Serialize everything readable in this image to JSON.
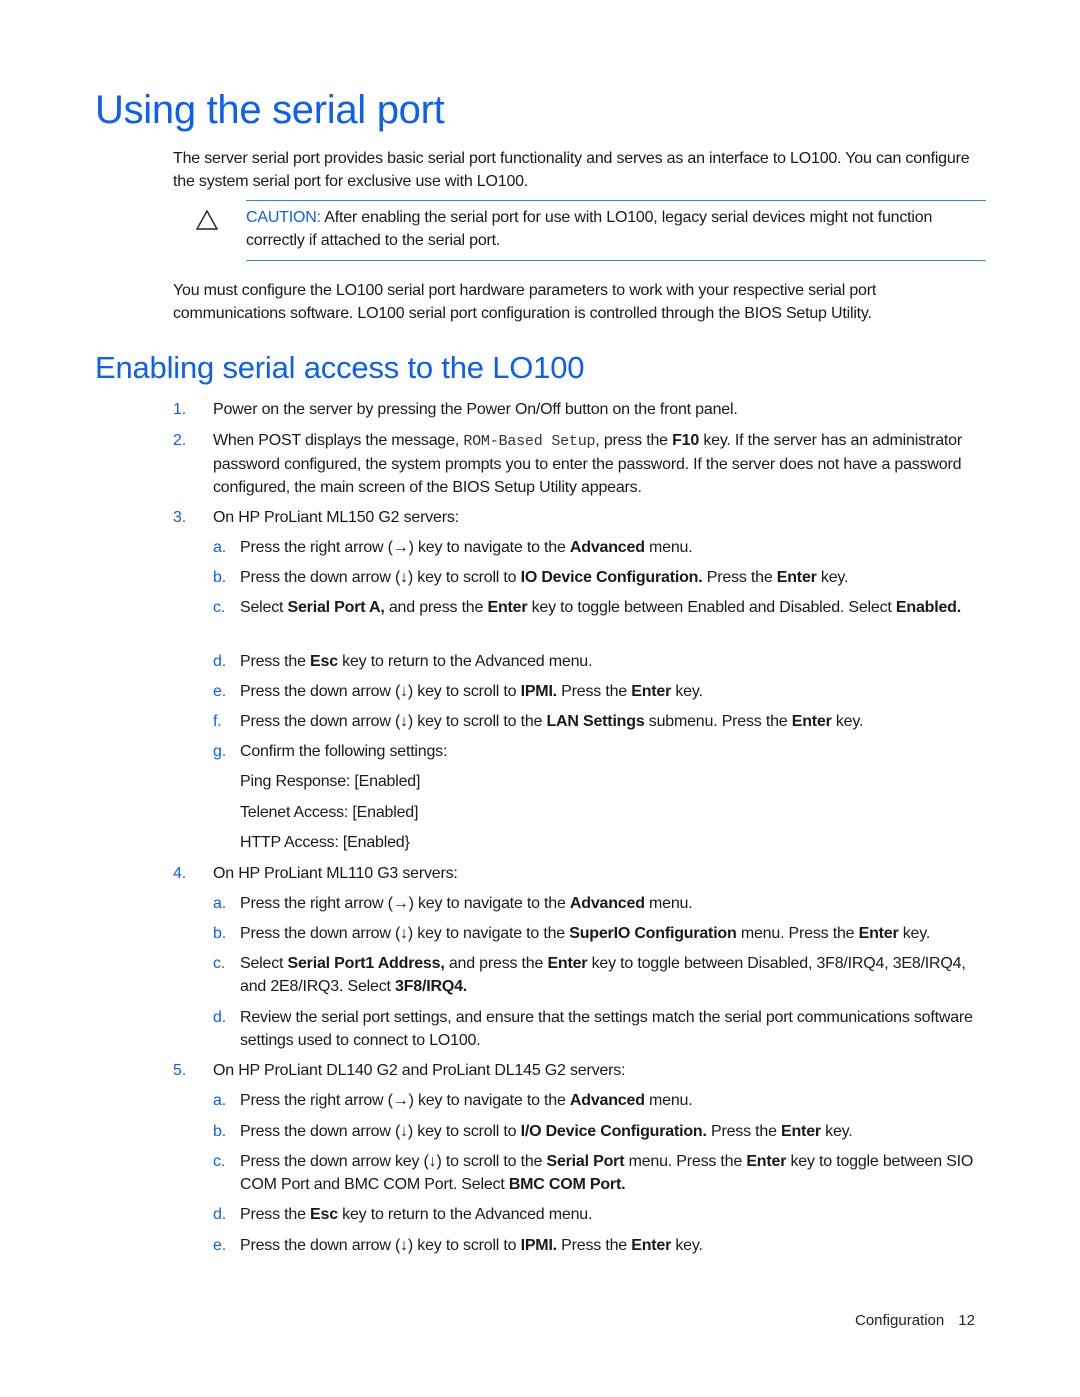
{
  "heading1": "Using the serial port",
  "intro": "The server serial port provides basic serial port functionality and serves as an interface to LO100. You can configure the system serial port for exclusive use with LO100.",
  "caution": {
    "icon": "warning-triangle-icon",
    "label": "CAUTION:",
    "text": "After enabling the serial port for use with LO100, legacy serial devices might not function correctly if attached to the serial port."
  },
  "para2": "You must configure the LO100 serial port hardware parameters to work with your respective serial port communications software. LO100 serial port configuration is controlled through the BIOS Setup Utility.",
  "heading2": "Enabling serial access to the LO100",
  "steps": [
    {
      "num": "1.",
      "text": "Power on the server by pressing the Power On/Off button on the front panel."
    },
    {
      "num": "2.",
      "pre": "When POST displays the message, ",
      "code": "ROM-Based Setup",
      "mid": ", press the ",
      "bold": "F10",
      "post": " key. If the server has an administrator password configured, the system prompts you to enter the password. If the server does not have a password configured, the main screen of the BIOS Setup Utility appears."
    },
    {
      "num": "3.",
      "text": "On HP ProLiant ML150 G2 servers:",
      "subs": [
        {
          "num": "a.",
          "parts": [
            "Press the right arrow (→) key to navigate to the ",
            "Advanced",
            " menu."
          ]
        },
        {
          "num": "b.",
          "parts": [
            "Press the down arrow (↓) key to scroll to ",
            "IO Device Configuration.",
            " Press the ",
            "Enter",
            " key."
          ]
        },
        {
          "num": "c.",
          "parts": [
            "Select ",
            "Serial Port A,",
            " and press the ",
            "Enter",
            " key to toggle between Enabled and Disabled. Select ",
            "Enabled."
          ]
        },
        {
          "num": "d.",
          "parts": [
            "Press the ",
            "Esc",
            " key to return to the Advanced menu."
          ]
        },
        {
          "num": "e.",
          "parts": [
            "Press the down arrow (↓) key to scroll to ",
            "IPMI.",
            " Press the ",
            "Enter",
            " key."
          ]
        },
        {
          "num": "f.",
          "parts": [
            "Press the down arrow (↓) key to scroll to the ",
            "LAN Settings",
            " submenu. Press the ",
            "Enter",
            " key."
          ]
        },
        {
          "num": "g.",
          "parts": [
            "Confirm the following settings:"
          ]
        }
      ],
      "settings": [
        "Ping Response: [Enabled]",
        "Telenet Access: [Enabled]",
        "HTTP Access: [Enabled}"
      ]
    },
    {
      "num": "4.",
      "text": "On HP ProLiant ML110 G3 servers:",
      "subs": [
        {
          "num": "a.",
          "parts": [
            "Press the right arrow (→) key to navigate to the ",
            "Advanced",
            " menu."
          ]
        },
        {
          "num": "b.",
          "parts": [
            "Press the down arrow (↓) key to navigate to the ",
            "SuperIO Configuration",
            " menu. Press the ",
            "Enter",
            " key."
          ]
        },
        {
          "num": "c.",
          "parts": [
            "Select ",
            "Serial Port1 Address,",
            " and press the ",
            "Enter",
            " key to toggle between Disabled, 3F8/IRQ4, 3E8/IRQ4, and 2E8/IRQ3. Select ",
            "3F8/IRQ4."
          ]
        },
        {
          "num": "d.",
          "parts": [
            "Review the serial port settings, and ensure that the settings match the serial port communications software settings used to connect to LO100."
          ]
        }
      ]
    },
    {
      "num": "5.",
      "text": "On HP ProLiant DL140 G2 and ProLiant DL145 G2 servers:",
      "subs": [
        {
          "num": "a.",
          "parts": [
            "Press the right arrow (→) key to navigate to the ",
            "Advanced",
            " menu."
          ]
        },
        {
          "num": "b.",
          "parts": [
            "Press the down arrow (↓) key to scroll to ",
            "I/O Device Configuration.",
            " Press the ",
            "Enter",
            " key."
          ]
        },
        {
          "num": "c.",
          "parts": [
            "Press the down arrow key (↓) to scroll to the ",
            "Serial Port",
            " menu. Press the ",
            "Enter",
            " key to toggle between SIO COM Port and BMC COM Port. Select ",
            "BMC COM Port."
          ]
        },
        {
          "num": "d.",
          "parts": [
            "Press the ",
            "Esc",
            " key to return to the Advanced menu."
          ]
        },
        {
          "num": "e.",
          "parts": [
            "Press the down arrow (↓) key to scroll to ",
            "IPMI.",
            " Press the ",
            "Enter",
            " key."
          ]
        }
      ]
    }
  ],
  "footer": {
    "section": "Configuration",
    "page": "12"
  }
}
